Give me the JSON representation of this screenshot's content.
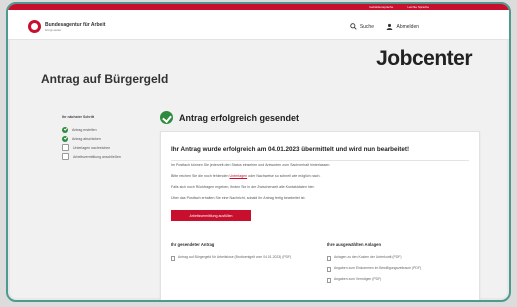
{
  "top_links": [
    "Gebärdensprache",
    "Leichte Sprache"
  ],
  "header": {
    "org_name": "Bundesagentur für Arbeit",
    "org_sub": "bringt weiter",
    "search_label": "Suche",
    "logout_label": "Abmelden"
  },
  "jobcenter": {
    "brand": "Jobcenter"
  },
  "page": {
    "title": "Antrag auf Bürgergeld"
  },
  "steps": {
    "heading": "Ihr nächster Schritt",
    "items": [
      {
        "label": "Antrag erstellen",
        "status": "done"
      },
      {
        "label": "Antrag abschicken",
        "status": "done"
      },
      {
        "label": "Unterlagen nachreichen",
        "status": "todo"
      },
      {
        "label": "Arbeitsvermittlung anschließen",
        "status": "todo"
      }
    ]
  },
  "success": {
    "title": "Antrag erfolgreich gesendet"
  },
  "card": {
    "heading": "Ihr Antrag wurde erfolgreich am 04.01.2023 übermittelt und wird nun bearbeitet!",
    "p1": "Im Postfach können Sie jederzeit den Status einsehen und Antworten zum Sachverhalt hinterlassen.",
    "p2_pre": "Bitte reichen Sie die noch fehlenden",
    "p2_link": "Unterlagen",
    "p2_post": "oder Nachweise so schnell wie möglich nach.",
    "p3": "Falls sich noch Rückfragen ergeben, finden Sie in der Zwischenzeit alle Kontaktdaten hier.",
    "p4": "Über das Postfach erhalten Sie eine Nachricht, sobald Ihr Antrag fertig bearbeitet ist.",
    "cta_label": "Arbeitsvermittlung ausfüllen",
    "left_col_title": "Ihr gesendeter Antrag",
    "left_col_items": [
      "Antrag auf Bürgergeld für Arbeitslose (Bruttoentgelt vom 04.01.2023) (PDF)"
    ],
    "right_col_title": "Ihre ausgewählten Anlagen",
    "right_col_items": [
      "Anlagen zu den Kosten der Unterkunft (PDF)",
      "Angaben zum Einkommen im Bewilligungszeitraum (PDF)",
      "Angaben zum Vermögen (PDF)"
    ]
  },
  "colors": {
    "accent": "#c8102e",
    "success": "#2e8b3e"
  }
}
